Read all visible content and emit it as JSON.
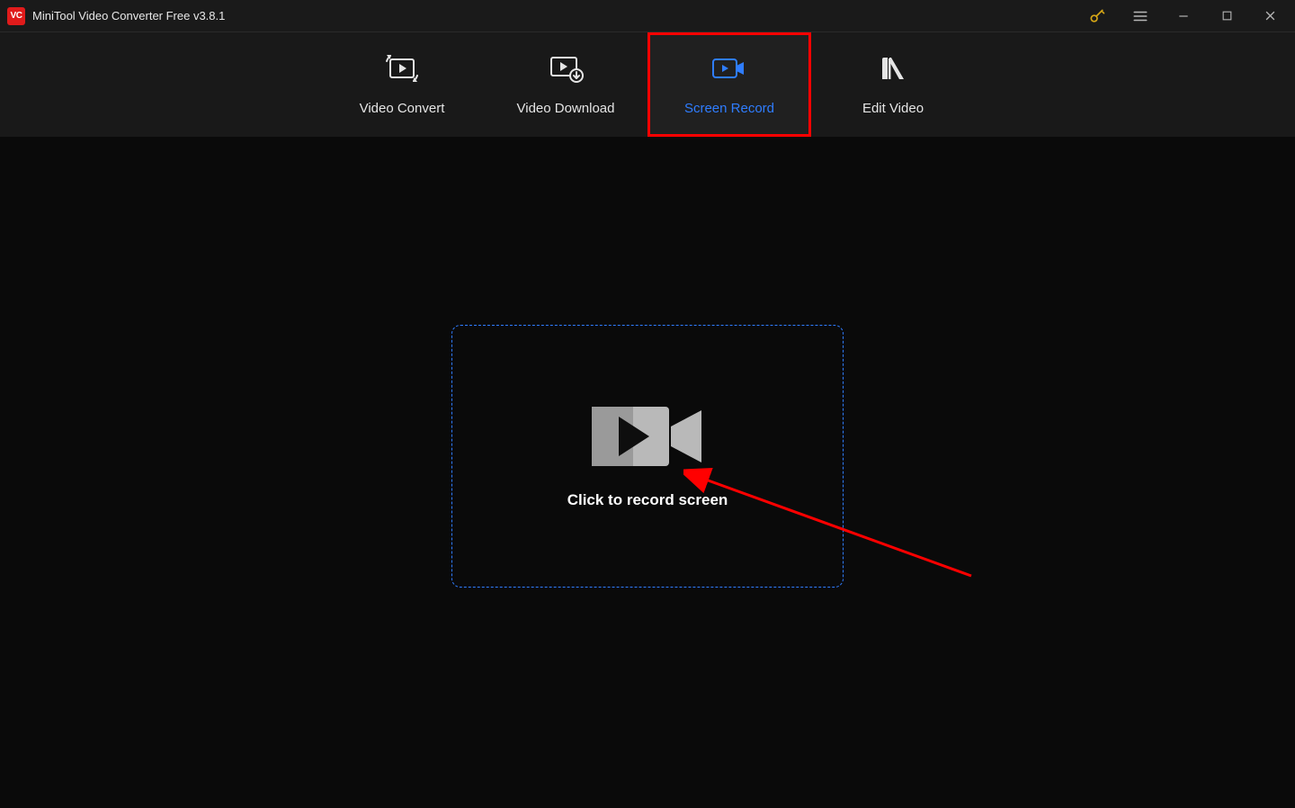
{
  "app": {
    "logo_text": "VC",
    "title": "MiniTool Video Converter Free v3.8.1"
  },
  "toolbar": {
    "items": [
      {
        "label": "Video Convert"
      },
      {
        "label": "Video Download"
      },
      {
        "label": "Screen Record"
      },
      {
        "label": "Edit Video"
      }
    ]
  },
  "main": {
    "record_cta": "Click to record screen"
  },
  "colors": {
    "accent": "#2f7dff",
    "highlight": "#ff0000",
    "key": "#d6a616"
  }
}
